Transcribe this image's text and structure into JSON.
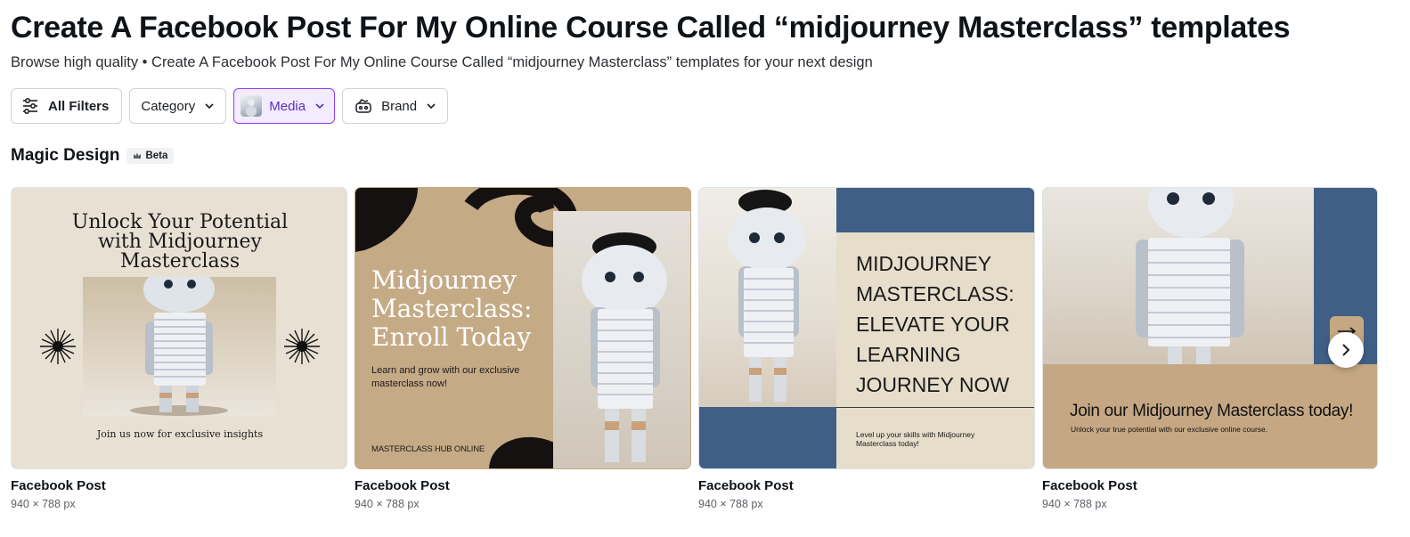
{
  "header": {
    "title": "Create A Facebook Post For My Online Course Called “midjourney Masterclass” templates",
    "subtitle": "Browse high quality • Create A Facebook Post For My Online Course Called “midjourney Masterclass” templates for your next design"
  },
  "filters": {
    "all_filters": "All Filters",
    "category": "Category",
    "media": "Media",
    "brand": "Brand"
  },
  "section": {
    "title": "Magic Design",
    "badge": "Beta"
  },
  "cards": [
    {
      "label": "Facebook Post",
      "dims": "940 × 788 px",
      "headline": "Unlock Your Potential with Midjourney Masterclass",
      "footer": "Join us now for exclusive insights"
    },
    {
      "label": "Facebook Post",
      "dims": "940 × 788 px",
      "headline": "Midjourney Masterclass: Enroll Today",
      "body": "Learn and grow with our exclusive masterclass now!",
      "footer": "MASTERCLASS HUB ONLINE"
    },
    {
      "label": "Facebook Post",
      "dims": "940 × 788 px",
      "headline": "MIDJOURNEY MASTERCLASS: ELEVATE YOUR LEARNING JOURNEY NOW",
      "body": "Level up your skills with Midjourney Masterclass today!"
    },
    {
      "label": "Facebook Post",
      "dims": "940 × 788 px",
      "headline": "Join our Midjourney Masterclass today!",
      "body": "Unlock your true potential with our exclusive online course."
    }
  ],
  "icons": {
    "filters": "sliders-icon",
    "chevron": "chevron-down-icon",
    "brand": "brand-kit-icon",
    "next": "chevron-right-icon",
    "crown": "crown-icon"
  },
  "colors": {
    "accent": "#8b3dff",
    "card1_bg": "#e8e1d3",
    "card2_bg": "#c5aa86",
    "card3_blue": "#3f5f86",
    "card4_bg": "#c5a883"
  }
}
